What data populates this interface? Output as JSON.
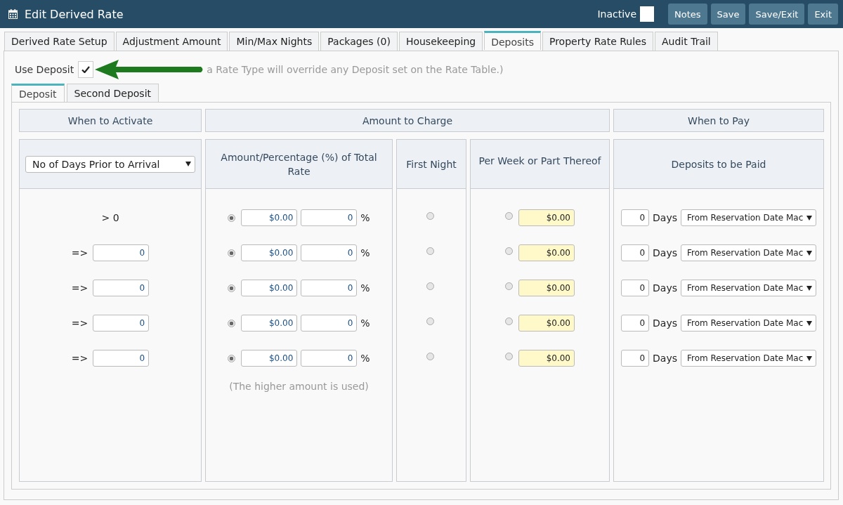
{
  "header": {
    "title": "Edit Derived Rate",
    "inactive_label": "Inactive",
    "inactive_checked": false,
    "buttons": [
      "Notes",
      "Save",
      "Save/Exit",
      "Exit"
    ]
  },
  "tabs": [
    {
      "label": "Derived Rate Setup",
      "selected": false
    },
    {
      "label": "Adjustment Amount",
      "selected": false
    },
    {
      "label": "Min/Max Nights",
      "selected": false
    },
    {
      "label": "Packages (0)",
      "selected": false
    },
    {
      "label": "Housekeeping",
      "selected": false
    },
    {
      "label": "Deposits",
      "selected": true
    },
    {
      "label": "Property Rate Rules",
      "selected": false
    },
    {
      "label": "Audit Trail",
      "selected": false
    }
  ],
  "use_deposit": {
    "label": "Use Deposit",
    "checked": true,
    "note": "a Rate Type will override any Deposit set on the Rate Table.)"
  },
  "sub_tabs": [
    {
      "label": "Deposit",
      "selected": true
    },
    {
      "label": "Second Deposit",
      "selected": false
    }
  ],
  "groups": [
    "When to Activate",
    "Amount to Charge",
    "When to Pay"
  ],
  "columns": {
    "activate_select": "No of Days Prior to Arrival",
    "amount": "Amount/Percentage (%) of Total Rate",
    "first_night": "First Night",
    "per_week": "Per Week or Part Thereof",
    "deposits": "Deposits to be Paid"
  },
  "rows": [
    {
      "kind": "text",
      "activate": "> 0",
      "amount_selected": true,
      "amount": "$0.00",
      "percent": "0",
      "percent_sign": "%",
      "first_night_selected": false,
      "per_week_selected": false,
      "per_week": "$0.00",
      "days": "0",
      "days_label": "Days",
      "from": "From Reservation Date Mac"
    },
    {
      "kind": "input",
      "operator": "=>",
      "activate": "0",
      "amount_selected": true,
      "amount": "$0.00",
      "percent": "0",
      "percent_sign": "%",
      "first_night_selected": false,
      "per_week_selected": false,
      "per_week": "$0.00",
      "days": "0",
      "days_label": "Days",
      "from": "From Reservation Date Mac"
    },
    {
      "kind": "input",
      "operator": "=>",
      "activate": "0",
      "amount_selected": true,
      "amount": "$0.00",
      "percent": "0",
      "percent_sign": "%",
      "first_night_selected": false,
      "per_week_selected": false,
      "per_week": "$0.00",
      "days": "0",
      "days_label": "Days",
      "from": "From Reservation Date Mac"
    },
    {
      "kind": "input",
      "operator": "=>",
      "activate": "0",
      "amount_selected": true,
      "amount": "$0.00",
      "percent": "0",
      "percent_sign": "%",
      "first_night_selected": false,
      "per_week_selected": false,
      "per_week": "$0.00",
      "days": "0",
      "days_label": "Days",
      "from": "From Reservation Date Mac"
    },
    {
      "kind": "input",
      "operator": "=>",
      "activate": "0",
      "amount_selected": true,
      "amount": "$0.00",
      "percent": "0",
      "percent_sign": "%",
      "first_night_selected": false,
      "per_week_selected": false,
      "per_week": "$0.00",
      "days": "0",
      "days_label": "Days",
      "from": "From Reservation Date Mac"
    }
  ],
  "amount_note": "(The higher amount is used)"
}
